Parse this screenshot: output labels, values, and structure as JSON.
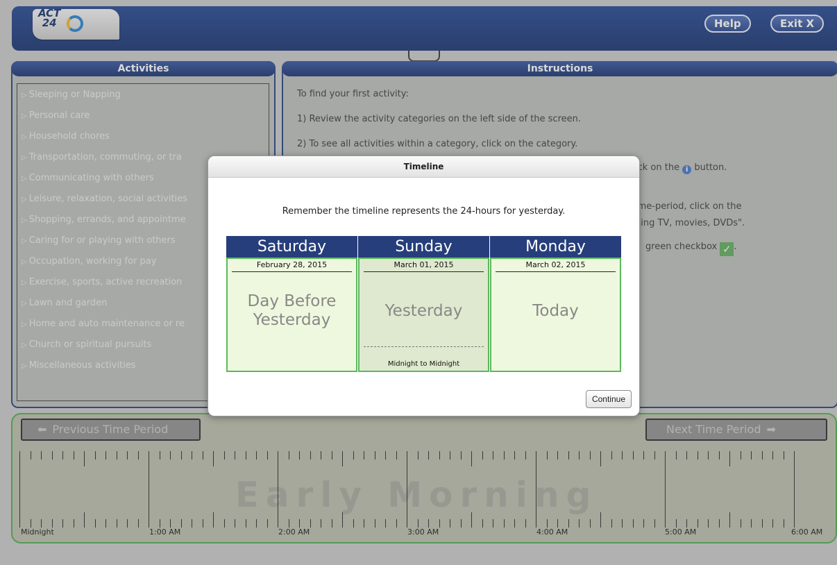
{
  "header": {
    "logo_text": "ACT\n24",
    "help_label": "Help",
    "exit_label": "Exit X"
  },
  "activities": {
    "title": "Activities",
    "items": [
      "Sleeping or Napping",
      "Personal care",
      "Household chores",
      "Transportation, commuting, or tra",
      "Communicating with others",
      "Leisure, relaxation, social activities",
      "Shopping, errands, and appointme",
      "Caring for or playing with others",
      "Occupation, working for pay",
      "Exercise, sports, active recreation",
      "Lawn and garden",
      "Home and auto maintenance or re",
      "Church or spiritual pursuits",
      "Miscellaneous activities"
    ]
  },
  "instructions": {
    "title": "Instructions",
    "line1": "To find your first activity:",
    "line2": "1) Review the activity categories on the left side of the screen.",
    "line3": "2) To see all activities within a category, click on the category.",
    "line4_tail": "ick on the",
    "line4_end": "button.",
    "line5": "ime-period, click on the",
    "line6": "hing TV, movies, DVDs\".",
    "line7": "green checkbox",
    "line7_end": "."
  },
  "timeline": {
    "prev_label": "Previous Time Period",
    "next_label": "Next Time Period",
    "period_label": "Early Morning",
    "hours": [
      "Midnight",
      "1:00 AM",
      "2:00 AM",
      "3:00 AM",
      "4:00 AM",
      "5:00 AM",
      "6:00 AM"
    ]
  },
  "modal": {
    "title": "Timeline",
    "message": "Remember the timeline represents the 24-hours for yesterday.",
    "days": [
      {
        "day": "Saturday",
        "date": "February 28, 2015",
        "label": "Day Before\nYesterday"
      },
      {
        "day": "Sunday",
        "date": "March 01, 2015",
        "label": "Yesterday",
        "note": "Midnight to Midnight"
      },
      {
        "day": "Monday",
        "date": "March 02, 2015",
        "label": "Today"
      }
    ],
    "continue_label": "Continue"
  },
  "colors": {
    "navy": "#0d2a6a",
    "green_border": "#4aa848",
    "day_bg": "#eef8de"
  }
}
